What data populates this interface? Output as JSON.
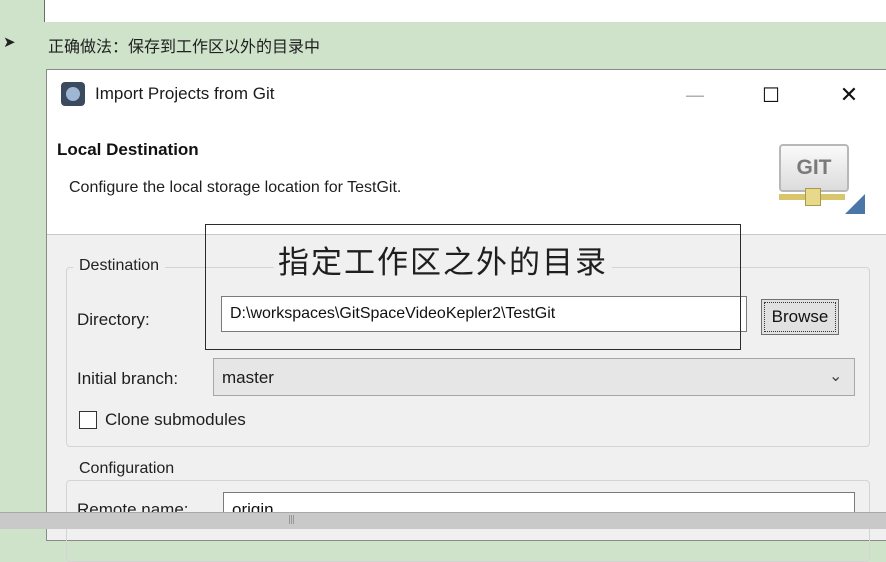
{
  "slide": {
    "bullet": "➤",
    "note": "正确做法：保存到工作区以外的目录中",
    "annotation": "指定工作区之外的目录"
  },
  "dialog": {
    "title": "Import Projects from Git",
    "controls": {
      "minimize": "—",
      "maximize": "☐",
      "close": "✕"
    },
    "header": {
      "title": "Local Destination",
      "description": "Configure the local storage location for TestGit.",
      "logo_text": "GIT"
    },
    "destination": {
      "group_label": "Destination",
      "directory_label": "Directory:",
      "directory_value": "D:\\workspaces\\GitSpaceVideoKepler2\\TestGit",
      "browse_label": "Browse",
      "branch_label": "Initial branch:",
      "branch_value": "master",
      "clone_label": "Clone submodules",
      "clone_checked": false
    },
    "configuration": {
      "group_label": "Configuration",
      "remote_label": "Remote name:",
      "remote_value": "origin"
    }
  },
  "icons": {
    "app": "eclipse-icon",
    "dropdown": "chevron-down-icon"
  },
  "colors": {
    "slide_background": "#cfe3cb",
    "dialog_background": "#f0f0f0",
    "annotation_border": "#2b2b2b"
  }
}
